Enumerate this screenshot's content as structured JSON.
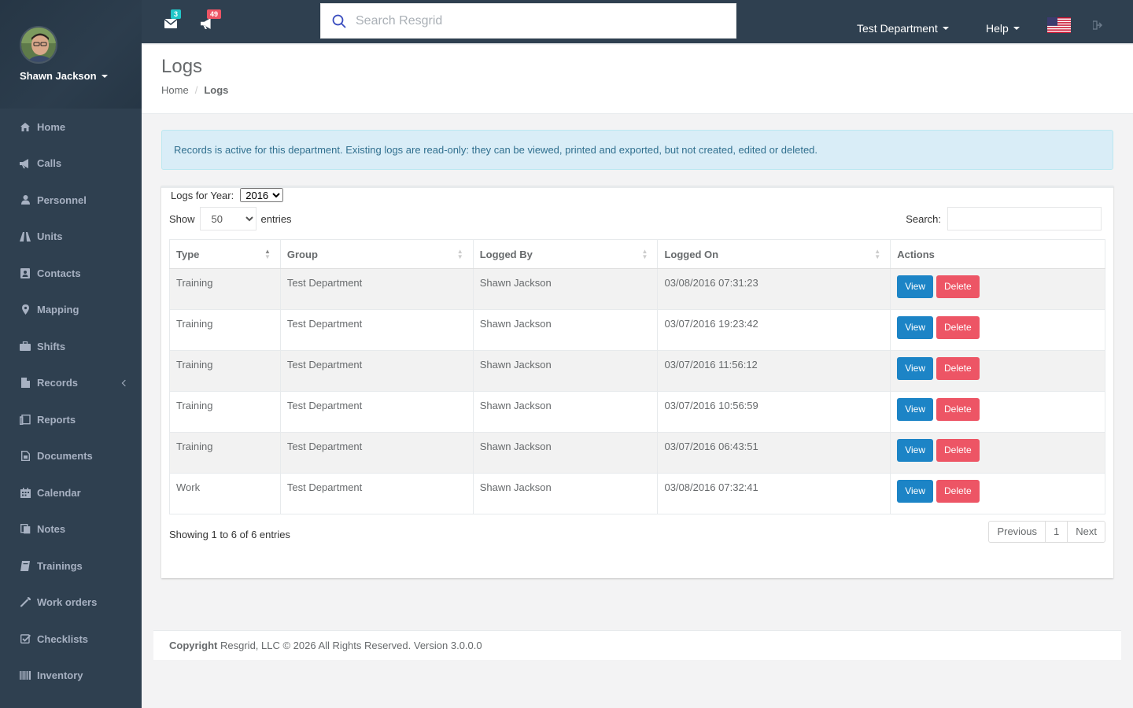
{
  "user": {
    "name": "Shawn Jackson"
  },
  "sidebar": {
    "items": [
      {
        "label": "Home",
        "icon": "home-icon"
      },
      {
        "label": "Calls",
        "icon": "bullhorn-icon"
      },
      {
        "label": "Personnel",
        "icon": "user-icon"
      },
      {
        "label": "Units",
        "icon": "road-icon"
      },
      {
        "label": "Contacts",
        "icon": "address-book-icon"
      },
      {
        "label": "Mapping",
        "icon": "map-marker-icon"
      },
      {
        "label": "Shifts",
        "icon": "briefcase-icon"
      },
      {
        "label": "Records",
        "icon": "file-icon"
      },
      {
        "label": "Reports",
        "icon": "reports-icon"
      },
      {
        "label": "Documents",
        "icon": "document-icon"
      },
      {
        "label": "Calendar",
        "icon": "calendar-icon"
      },
      {
        "label": "Notes",
        "icon": "notes-icon"
      },
      {
        "label": "Trainings",
        "icon": "book-icon"
      },
      {
        "label": "Work orders",
        "icon": "wrench-icon"
      },
      {
        "label": "Checklists",
        "icon": "checkbox-icon"
      },
      {
        "label": "Inventory",
        "icon": "barcode-icon"
      }
    ]
  },
  "topbar": {
    "messages_count": "3",
    "notifications_count": "49",
    "search_placeholder": "Search Resgrid",
    "department_menu": "Test Department",
    "help_menu": "Help"
  },
  "page": {
    "title": "Logs",
    "breadcrumb_home": "Home",
    "breadcrumb_current": "Logs"
  },
  "alert": "Records is active for this department. Existing logs are read-only: they can be viewed, printed and exported, but not created, edited or deleted.",
  "logs": {
    "year_label": "Logs for Year:",
    "year_value": "2016",
    "show_label": "Show",
    "entries_value": "50",
    "entries_label": "entries",
    "search_label": "Search:",
    "columns": [
      "Type",
      "Group",
      "Logged By",
      "Logged On",
      "Actions"
    ],
    "rows": [
      {
        "type": "Training",
        "group": "Test Department",
        "logged_by": "Shawn Jackson",
        "logged_on": "03/08/2016 07:31:23"
      },
      {
        "type": "Training",
        "group": "Test Department",
        "logged_by": "Shawn Jackson",
        "logged_on": "03/07/2016 19:23:42"
      },
      {
        "type": "Training",
        "group": "Test Department",
        "logged_by": "Shawn Jackson",
        "logged_on": "03/07/2016 11:56:12"
      },
      {
        "type": "Training",
        "group": "Test Department",
        "logged_by": "Shawn Jackson",
        "logged_on": "03/07/2016 10:56:59"
      },
      {
        "type": "Training",
        "group": "Test Department",
        "logged_by": "Shawn Jackson",
        "logged_on": "03/07/2016 06:43:51"
      },
      {
        "type": "Work",
        "group": "Test Department",
        "logged_by": "Shawn Jackson",
        "logged_on": "03/08/2016 07:32:41"
      }
    ],
    "view_label": "View",
    "delete_label": "Delete",
    "info": "Showing 1 to 6 of 6 entries",
    "prev_label": "Previous",
    "page_number": "1",
    "next_label": "Next"
  },
  "footer": {
    "copyright_bold": "Copyright",
    "copyright_text": " Resgrid, LLC © 2026 All Rights Reserved.",
    "version": " Version 3.0.0.0"
  },
  "colors": {
    "sidebar_bg": "#2f4050",
    "view_button": "#1c84c6",
    "delete_button": "#ed5565",
    "messages_badge": "#23c6c8",
    "notifications_badge": "#ed5565"
  }
}
